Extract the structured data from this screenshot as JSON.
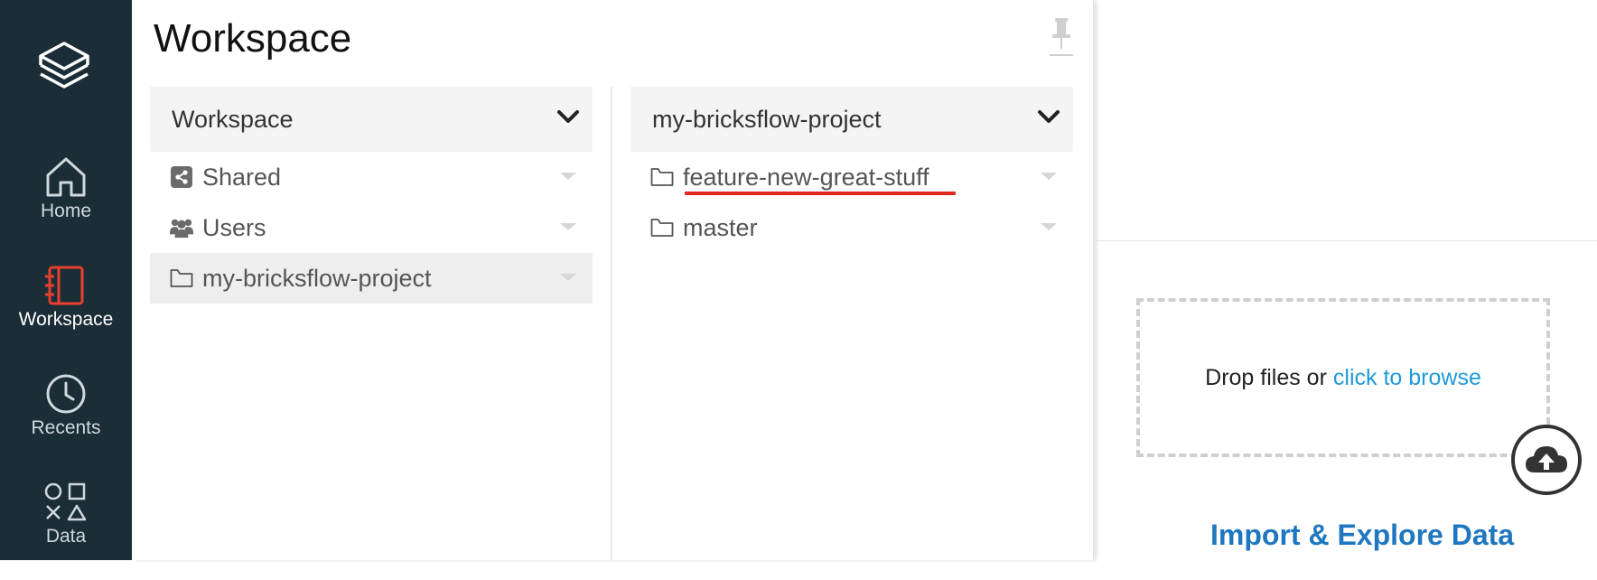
{
  "nav": {
    "logo": "layers-icon",
    "items": [
      {
        "label": "Home",
        "icon": "home-icon"
      },
      {
        "label": "Workspace",
        "icon": "notebook-icon",
        "active": true
      },
      {
        "label": "Recents",
        "icon": "clock-icon"
      },
      {
        "label": "Data",
        "icon": "shapes-icon"
      }
    ],
    "active_color": "#e8402e"
  },
  "panel": {
    "title": "Workspace",
    "pin_icon": "pin-icon",
    "columns": [
      {
        "header": "Workspace",
        "items": [
          {
            "label": "Shared",
            "icon": "share-icon"
          },
          {
            "label": "Users",
            "icon": "users-icon"
          },
          {
            "label": "my-bricksflow-project",
            "icon": "folder-icon",
            "selected": true
          }
        ]
      },
      {
        "header": "my-bricksflow-project",
        "items": [
          {
            "label": "feature-new-great-stuff",
            "icon": "folder-icon",
            "highlighted": true
          },
          {
            "label": "master",
            "icon": "folder-icon"
          }
        ]
      }
    ]
  },
  "upload": {
    "drop_text": "Drop files or",
    "browse_link": "click to browse",
    "icon": "cloud-upload-icon",
    "import_title": "Import & Explore Data"
  },
  "colors": {
    "rail_bg": "#1b2d36",
    "link": "#1f9bd6",
    "import": "#1e77c0",
    "highlight_underline": "#e0281f"
  }
}
